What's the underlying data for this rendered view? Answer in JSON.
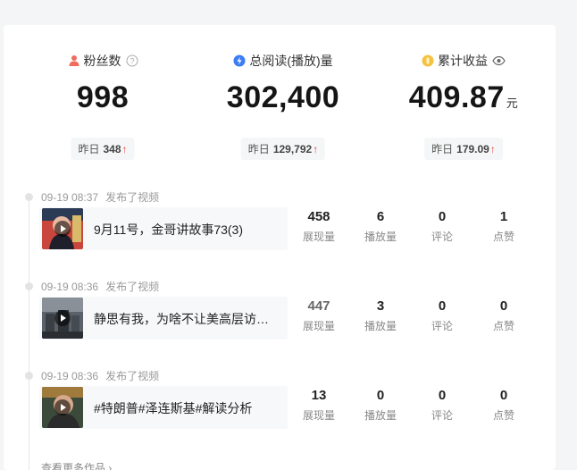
{
  "stats": [
    {
      "label": "粉丝数",
      "value": "998",
      "unit": "",
      "yesterday_label": "昨日",
      "yesterday_value": "348",
      "trend": "↑",
      "icon": "user-icon",
      "extra_icon": "help-icon"
    },
    {
      "label": "总阅读(播放)量",
      "value": "302,400",
      "unit": "",
      "yesterday_label": "昨日",
      "yesterday_value": "129,792",
      "trend": "↑",
      "icon": "lightning-icon",
      "extra_icon": ""
    },
    {
      "label": "累计收益",
      "value": "409.87",
      "unit": "元",
      "yesterday_label": "昨日",
      "yesterday_value": "179.09",
      "trend": "↑",
      "icon": "coin-icon",
      "extra_icon": "eye-icon"
    }
  ],
  "feed": [
    {
      "time": "09-19 08:37",
      "action": "发布了视频",
      "title": "9月11号，金哥讲故事73(3)",
      "metrics": [
        {
          "value": "458",
          "label": "展现量"
        },
        {
          "value": "6",
          "label": "播放量"
        },
        {
          "value": "0",
          "label": "评论"
        },
        {
          "value": "1",
          "label": "点赞"
        }
      ]
    },
    {
      "time": "09-19 08:36",
      "action": "发布了视频",
      "title": "静思有我，为啥不让美高层访问？",
      "metrics": [
        {
          "value": "447",
          "label": "展现量"
        },
        {
          "value": "3",
          "label": "播放量"
        },
        {
          "value": "0",
          "label": "评论"
        },
        {
          "value": "0",
          "label": "点赞"
        }
      ]
    },
    {
      "time": "09-19 08:36",
      "action": "发布了视频",
      "title": "#特朗普#泽连斯基#解读分析",
      "metrics": [
        {
          "value": "13",
          "label": "展现量"
        },
        {
          "value": "0",
          "label": "播放量"
        },
        {
          "value": "0",
          "label": "评论"
        },
        {
          "value": "0",
          "label": "点赞"
        }
      ]
    }
  ],
  "more_link": "查看更多作品 ›",
  "colors": {
    "accent_up": "#f04142",
    "user_icon": "#f06b5b",
    "lightning_icon": "#3c7cf5",
    "coin_icon": "#f5c242"
  }
}
